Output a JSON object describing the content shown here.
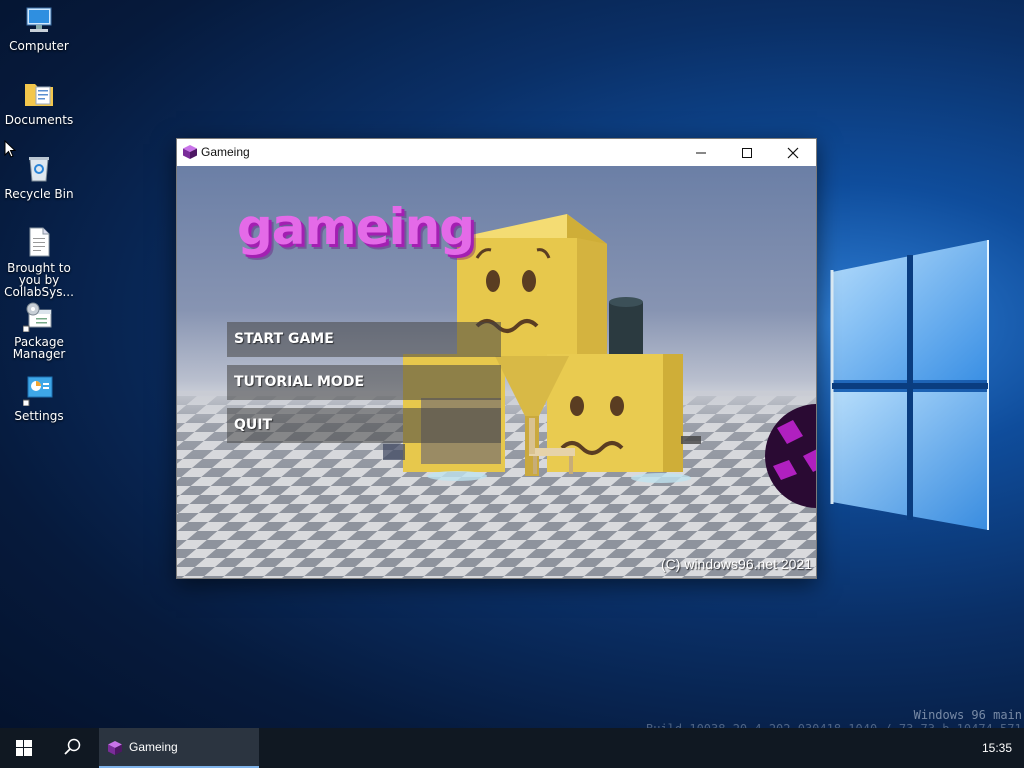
{
  "desktop": {
    "icons": [
      {
        "label": "Computer"
      },
      {
        "label": "Documents"
      },
      {
        "label": "Recycle Bin"
      },
      {
        "label": "Brought to you by CollabSys..."
      },
      {
        "label": "Package Manager"
      },
      {
        "label": "Settings"
      }
    ],
    "watermark_line1": "Windows 96 main",
    "watermark_line2": "Build 10038.20.4 202 030418 1040 / 73 73 b 10474 571"
  },
  "window": {
    "title": "Gameing",
    "controls": {
      "minimize": "minimize",
      "maximize": "maximize",
      "close": "close"
    }
  },
  "game": {
    "title": "gameing",
    "menu": [
      {
        "label": "START GAME"
      },
      {
        "label": "TUTORIAL MODE"
      },
      {
        "label": "QUIT"
      }
    ],
    "copyright": "(C) windows96.net 2021",
    "colors": {
      "title": "#e46ae8",
      "title_shadow": "#a31fb2",
      "cube": "#e8c84a"
    }
  },
  "taskbar": {
    "items": [
      {
        "label": "Gameing",
        "active": true
      }
    ],
    "clock": "15:35"
  }
}
